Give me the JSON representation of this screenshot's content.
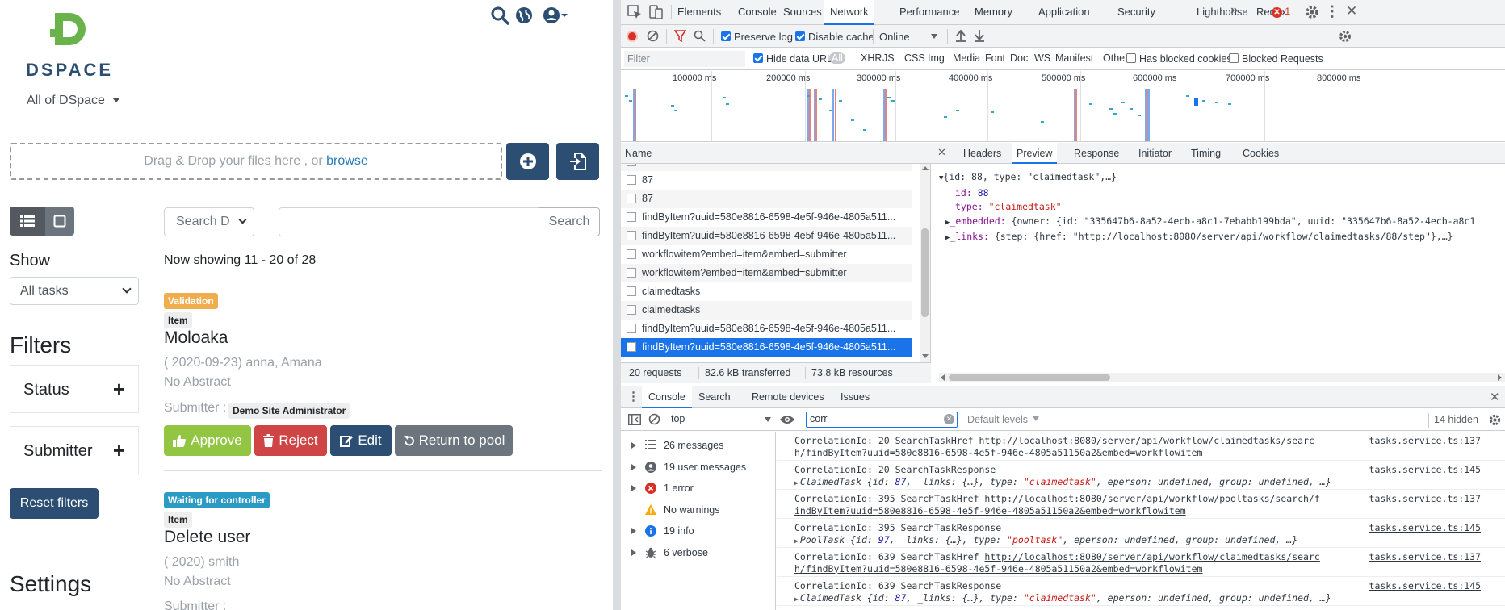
{
  "dspace": {
    "logo_text": "DSPACE",
    "community_menu": "All of DSpace",
    "dropzone_text": "Drag & Drop your files here , or",
    "browse_link": "browse",
    "search_dropdown": "Search D",
    "search_button": "Search",
    "show_label": "Show",
    "show_select": "All tasks",
    "filters_heading": "Filters",
    "filter_status": "Status",
    "filter_submitter": "Submitter",
    "reset_filters": "Reset filters",
    "settings_heading": "Settings",
    "showing_text": "Now showing 11 - 20 of 28",
    "items": [
      {
        "status_badge": "Validation",
        "type_badge": "Item",
        "title": "Moloaka",
        "meta": "( 2020-09-23) anna, Amana",
        "abstract": "No Abstract",
        "submitter_label": "Submitter :",
        "submitter": "Demo Site Administrator",
        "actions": {
          "approve": "Approve",
          "reject": "Reject",
          "edit": "Edit",
          "return": "Return to pool"
        }
      },
      {
        "status_badge": "Waiting for controller",
        "type_badge": "Item",
        "title": "Delete user",
        "meta": "( 2020) smith",
        "abstract": "No Abstract",
        "submitter_label": "Submitter :"
      }
    ],
    "colors": {
      "primary": "#2b4e72",
      "success": "#92c642",
      "danger": "#cf4444",
      "secondary": "#6c757d",
      "validation": "#f0ad4e",
      "info": "#2b9bc4",
      "logo": "#6ab24a"
    }
  },
  "devtools": {
    "tabs": [
      "Elements",
      "Console",
      "Sources",
      "Network",
      "Performance",
      "Memory",
      "Application",
      "Security",
      "Lighthouse",
      "Redux"
    ],
    "active_tab": "Network",
    "error_count": "1",
    "toolbar": {
      "preserve_log": "Preserve log",
      "disable_cache": "Disable cache",
      "throttle": "Online"
    },
    "filter_placeholder": "Filter",
    "hide_data_urls": "Hide data URLs",
    "type_filters": [
      "All",
      "XHR",
      "JS",
      "CSS",
      "Img",
      "Media",
      "Font",
      "Doc",
      "WS",
      "Manifest",
      "Other"
    ],
    "has_blocked_cookies": "Has blocked cookies",
    "blocked_requests": "Blocked Requests",
    "timeline_ticks": [
      "100000 ms",
      "200000 ms",
      "300000 ms",
      "400000 ms",
      "500000 ms",
      "600000 ms",
      "700000 ms",
      "800000 ms"
    ],
    "name_header": "Name",
    "requests": [
      {
        "name": "87"
      },
      {
        "name": "87"
      },
      {
        "name": "findByItem?uuid=580e8816-6598-4e5f-946e-4805a511..."
      },
      {
        "name": "findByItem?uuid=580e8816-6598-4e5f-946e-4805a511..."
      },
      {
        "name": "workflowitem?embed=item&embed=submitter"
      },
      {
        "name": "workflowitem?embed=item&embed=submitter"
      },
      {
        "name": "claimedtasks"
      },
      {
        "name": "claimedtasks"
      },
      {
        "name": "findByItem?uuid=580e8816-6598-4e5f-946e-4805a511..."
      },
      {
        "name": "findByItem?uuid=580e8816-6598-4e5f-946e-4805a511..."
      }
    ],
    "status_bar": {
      "requests": "20 requests",
      "transferred": "82.6 kB transferred",
      "resources": "73.8 kB resources"
    },
    "detail_tabs": [
      "Headers",
      "Preview",
      "Response",
      "Initiator",
      "Timing",
      "Cookies"
    ],
    "active_detail_tab": "Preview",
    "preview": {
      "root": "{id: 88, type: \"claimedtask\",…}",
      "id_key": "id:",
      "id_val": "88",
      "type_key": "type:",
      "type_val": "\"claimedtask\"",
      "embedded_key": "_embedded:",
      "embedded_val": "{owner: {id: \"335647b6-8a52-4ecb-a8c1-7ebabb199bda\", uuid: \"335647b6-8a52-4ecb-a8c1",
      "links_key": "_links:",
      "links_val": "{step: {href: \"http://localhost:8080/server/api/workflow/claimedtasks/88/step\"},…}"
    },
    "drawer_tabs": [
      "Console",
      "Search",
      "Remote devices",
      "Issues"
    ],
    "console_context": "top",
    "console_filter": "corr",
    "default_levels": "Default levels",
    "hidden_count": "14 hidden",
    "sidebar": [
      {
        "label": "26 messages",
        "icon": "list-icon"
      },
      {
        "label": "19 user messages",
        "icon": "user-icon"
      },
      {
        "label": "1 error",
        "icon": "error-icon"
      },
      {
        "label": "No warnings",
        "icon": "warning-icon"
      },
      {
        "label": "19 info",
        "icon": "info-icon"
      },
      {
        "label": "6 verbose",
        "icon": "bug-icon"
      }
    ],
    "logs": [
      {
        "l1": "CorrelationId: 20 SearchTaskHref ",
        "link1": "http://localhost:8080/server/api/workflow/claimedtasks/searc",
        "l2link": "h/findByItem?uuid=580e8816-6598-4e5f-946e-4805a51150a2&embed=workflowitem",
        "src": "tasks.service.ts:137"
      },
      {
        "l1": "CorrelationId: 20 SearchTaskResponse",
        "obj_name": "ClaimedTask",
        "obj_rest_a": " {id: ",
        "obj_num": "87",
        "obj_rest_b": ", _links: {…}, type: ",
        "obj_str": "\"claimedtask\"",
        "obj_rest_c": ", eperson: undefined, group: undefined, …}",
        "src": "tasks.service.ts:145"
      },
      {
        "l1": "CorrelationId: 395 SearchTaskHref ",
        "link1": "http://localhost:8080/server/api/workflow/pooltasks/search/f",
        "l2link": "indByItem?uuid=580e8816-6598-4e5f-946e-4805a51150a2&embed=workflowitem",
        "src": "tasks.service.ts:137"
      },
      {
        "l1": "CorrelationId: 395 SearchTaskResponse",
        "obj_name": "PoolTask",
        "obj_rest_a": " {id: ",
        "obj_num": "97",
        "obj_rest_b": ", _links: {…}, type: ",
        "obj_str": "\"pooltask\"",
        "obj_rest_c": ", eperson: undefined, group: undefined, …}",
        "src": "tasks.service.ts:145"
      },
      {
        "l1": "CorrelationId: 639 SearchTaskHref ",
        "link1": "http://localhost:8080/server/api/workflow/claimedtasks/searc",
        "l2link": "h/findByItem?uuid=580e8816-6598-4e5f-946e-4805a51150a2&embed=workflowitem",
        "src": "tasks.service.ts:137"
      },
      {
        "l1": "CorrelationId: 639 SearchTaskResponse",
        "obj_name": "ClaimedTask",
        "obj_rest_a": " {id: ",
        "obj_num": "87",
        "obj_rest_b": ", _links: {…}, type: ",
        "obj_str": "\"claimedtask\"",
        "obj_rest_c": ", eperson: undefined, group: undefined, …}",
        "src": "tasks.service.ts:145"
      }
    ]
  }
}
